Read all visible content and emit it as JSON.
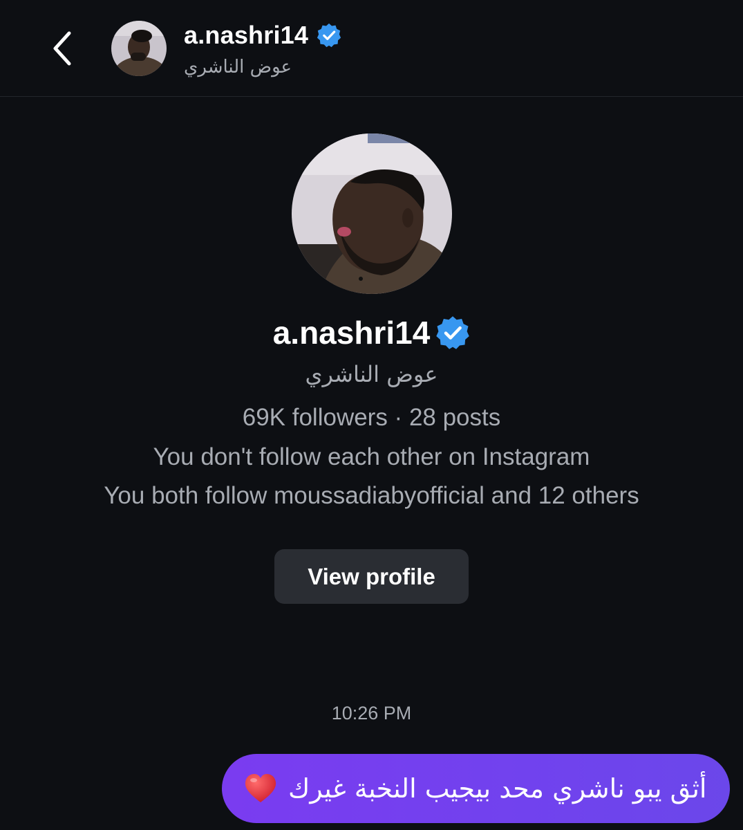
{
  "header": {
    "back_icon": "chevron-left-icon",
    "username": "a.nashri14",
    "fullname": "عوض الناشري",
    "verified_icon": "verified-badge-icon"
  },
  "profile": {
    "username": "a.nashri14",
    "fullname": "عوض الناشري",
    "stats": "69K followers · 28 posts",
    "follow_status": "You don't follow each other on Instagram",
    "mutual": "You both follow moussadiabyofficial and 12 others",
    "view_profile_label": "View profile"
  },
  "conversation": {
    "timestamp": "10:26 PM",
    "messages": [
      {
        "text": "أثق يبو ناشري محد بيجيب النخبة غيرك",
        "emoji_icon": "red-heart-icon",
        "sender": "me"
      }
    ]
  },
  "colors": {
    "background": "#0d0f13",
    "bubble_start": "#7a3cf0",
    "bubble_end": "#6b47ea",
    "verified": "#3897f0",
    "secondary_text": "#a8acb3",
    "button_bg": "#2a2d33"
  }
}
